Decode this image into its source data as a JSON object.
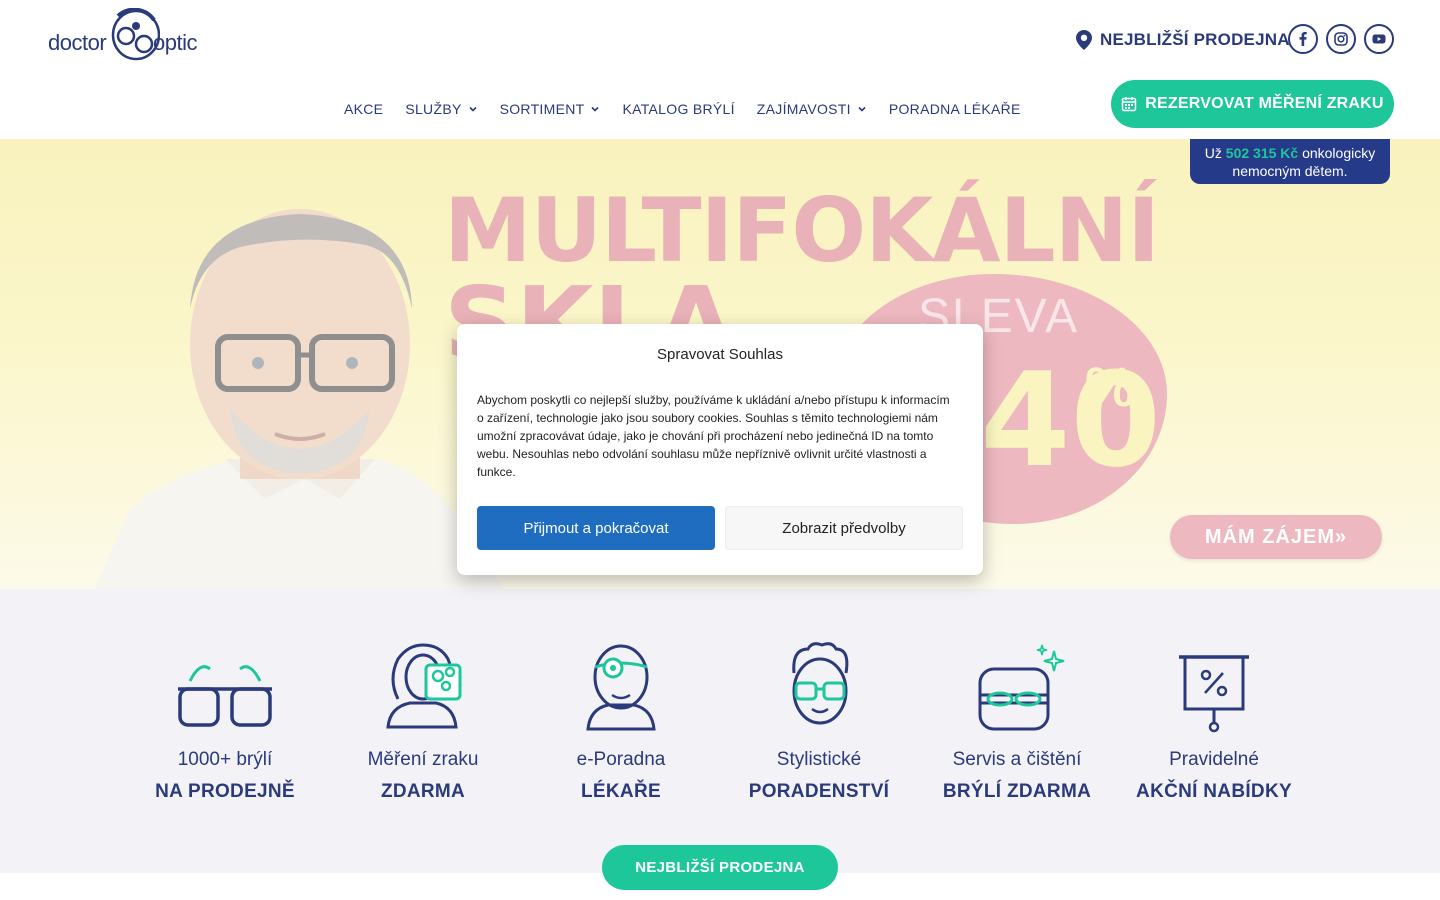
{
  "colors": {
    "brand_navy": "#2b3a7a",
    "brand_green": "#1ec79a",
    "accept_blue": "#1e6dc0",
    "hero_pink": "#de7f8b",
    "hero_yellow": "#f4e889"
  },
  "header": {
    "logo_left": "doctor",
    "logo_right": "optic",
    "store_link": "NEJBLIŽŠÍ PRODEJNA",
    "social": [
      "facebook-icon",
      "instagram-icon",
      "youtube-icon"
    ],
    "reserve_button": "REZERVOVAT MĚŘENÍ ZRAKU"
  },
  "nav": {
    "items": [
      {
        "label": "AKCE",
        "dropdown": false
      },
      {
        "label": "SLUŽBY",
        "dropdown": true
      },
      {
        "label": "SORTIMENT",
        "dropdown": true
      },
      {
        "label": "KATALOG BRÝLÍ",
        "dropdown": false
      },
      {
        "label": "ZAJÍMAVOSTI",
        "dropdown": true
      },
      {
        "label": "PORADNA LÉKAŘE",
        "dropdown": false
      }
    ]
  },
  "charity": {
    "prefix": "Už",
    "amount": "502 315 Kč",
    "suffix_line1": "onkologicky",
    "line2": "nemocným dětem."
  },
  "hero": {
    "headline_line1": "MULTIFOKÁLNÍ",
    "headline_line2": "SKLA",
    "badge_top": "SLEVA",
    "badge_value": "40",
    "badge_sign": "%",
    "cta": "MÁM ZÁJEM»"
  },
  "features": [
    {
      "line1": "1000+ brýlí",
      "line2": "NA PRODEJNĚ",
      "icon": "glasses-icon"
    },
    {
      "line1": "Měření zraku",
      "line2": "ZDARMA",
      "icon": "eye-test-icon"
    },
    {
      "line1": "e-Poradna",
      "line2": "LÉKAŘE",
      "icon": "doctor-icon"
    },
    {
      "line1": "Stylistické",
      "line2": "PORADENSTVÍ",
      "icon": "stylist-icon"
    },
    {
      "line1": "Servis a čištění",
      "line2": "BRÝLÍ ZDARMA",
      "icon": "lens-case-icon"
    },
    {
      "line1": "Pravidelné",
      "line2": "AKČNÍ NABÍDKY",
      "icon": "discount-board-icon"
    }
  ],
  "store_button": "NEJBLIŽŠÍ PRODEJNA",
  "consent": {
    "title": "Spravovat Souhlas",
    "body": "Abychom poskytli co nejlepší služby, používáme k ukládání a/nebo přístupu k informacím o zařízení, technologie jako jsou soubory cookies. Souhlas s těmito technologiemi nám umožní zpracovávat údaje, jako je chování při procházení nebo jedinečná ID na tomto webu. Nesouhlas nebo odvolání souhlasu může nepříznivě ovlivnit určité vlastnosti a funkce.",
    "accept": "Přijmout a pokračovat",
    "preferences": "Zobrazit předvolby"
  }
}
